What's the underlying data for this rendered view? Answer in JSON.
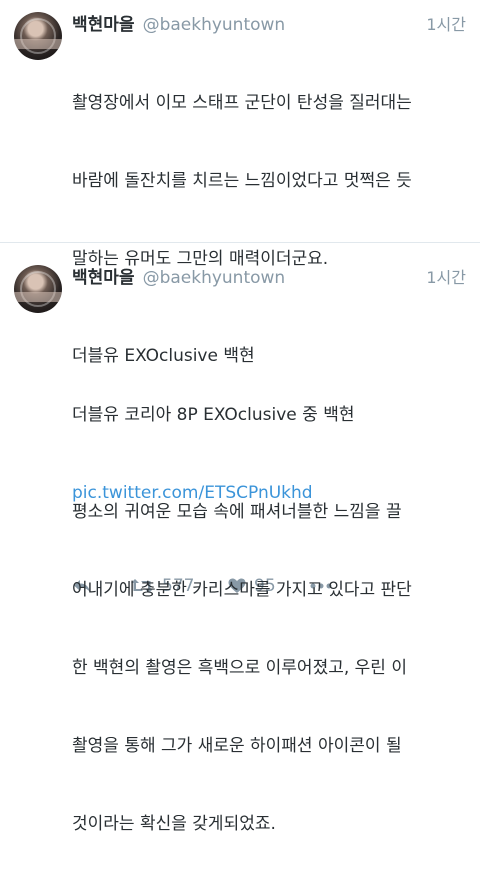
{
  "tweets": [
    {
      "display_name": "백현마을",
      "handle": "@baekhyuntown",
      "time": "1시간",
      "text_lines": [
        "촬영장에서 이모 스태프 군단이 탄성을 질러대는",
        "바람에 돌잔치를 치르는 느낌이었다고 멋쩍은 듯",
        "말하는 유머도 그만의 매력이더군요.",
        "",
        "더블유 코리아 8P EXOclusive 중 백현"
      ],
      "link": "pic.twitter.com/ETSCPnUkhd",
      "retweet_count": "577",
      "like_count": "95"
    },
    {
      "display_name": "백현마을",
      "handle": "@baekhyuntown",
      "time": "1시간",
      "text_lines": [
        "더블유 EXOclusive 백현",
        "",
        "평소의 귀여운 모습 속에 패셔너블한 느낌을 끌",
        "어내기에 충분한 카리스마를 가지고 있다고 판단",
        "한 백현의 촬영은 흑백으로 이루어졌고, 우린 이",
        "촬영을 통해 그가 새로운 하이패션 아이콘이 될",
        "것이라는 확신을 갖게되었죠."
      ]
    }
  ],
  "icons": {
    "reply": "reply-icon",
    "retweet": "retweet-icon",
    "like": "heart-icon",
    "more": "more-icon"
  },
  "colors": {
    "text": "#292f33",
    "muted": "#8899a6",
    "link": "#3b94d9",
    "divider": "#e1e8ed"
  }
}
